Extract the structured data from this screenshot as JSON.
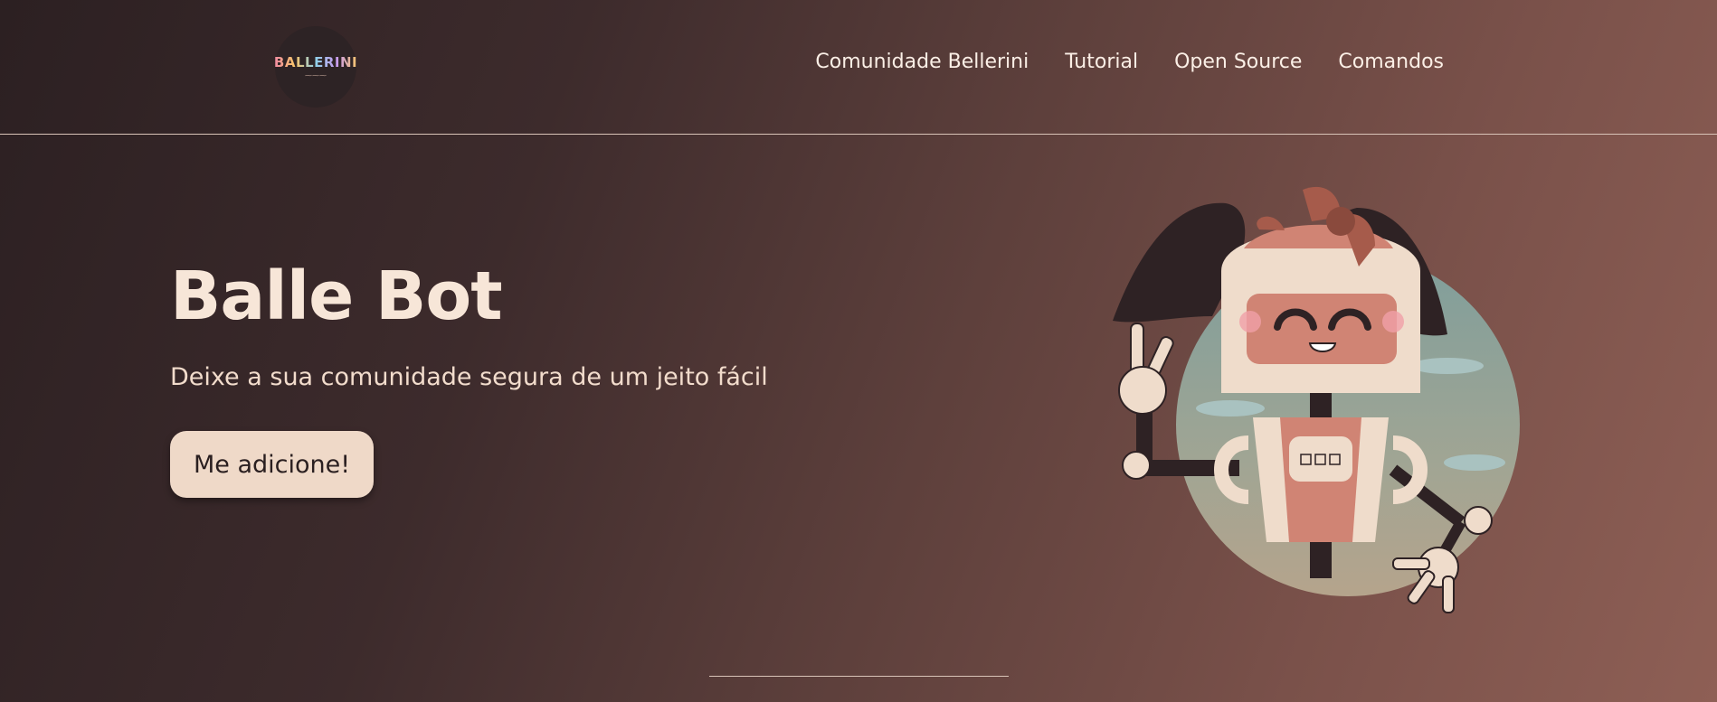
{
  "header": {
    "logo_text": "BALLERINI",
    "logo_subtext": "⁓⁓⁓",
    "nav": [
      {
        "label": "Comunidade Bellerini"
      },
      {
        "label": "Tutorial"
      },
      {
        "label": "Open Source"
      },
      {
        "label": "Comandos"
      }
    ]
  },
  "hero": {
    "title": "Balle Bot",
    "subtitle": "Deixe a sua comunidade segura de um jeito fácil",
    "cta_label": "Me adicione!"
  },
  "colors": {
    "background_dark": "#2c2022",
    "background_light": "#8e5f55",
    "text": "#f7e6d8",
    "button_bg": "#efd9c8",
    "robot_accent": "#d08474"
  },
  "icons": {
    "logo": "ballerini-logo-icon",
    "illustration": "robot-mascot-illustration"
  }
}
